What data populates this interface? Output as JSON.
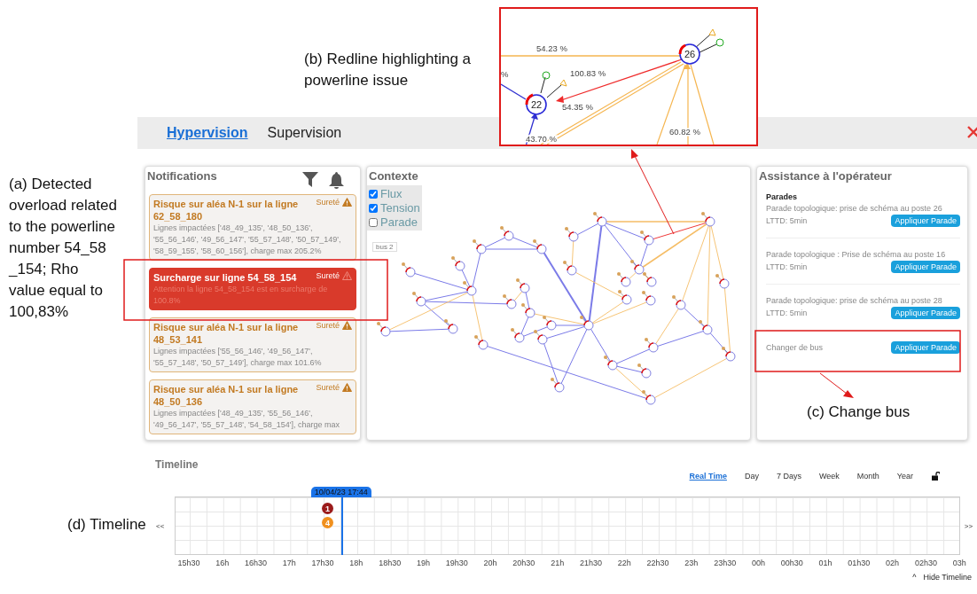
{
  "annotations": [
    {
      "kind": "a",
      "text": "(a) Detected overload related to the powerline number  54_58 _154; Rho value  equal to 100,83%"
    },
    {
      "kind": "b",
      "text": "(b) Redline highlighting a powerline issue"
    },
    {
      "kind": "c",
      "text": "(c) Change bus"
    },
    {
      "kind": "d",
      "text": "(d) Timeline"
    }
  ],
  "inset": {
    "flow_labels": [
      "54.23 %",
      "100.83 %",
      "54.35 %",
      "43.70 %",
      "60.82 %"
    ],
    "left_label": "%",
    "nodes": [
      "22",
      "26"
    ]
  },
  "header": {
    "tabs": [
      {
        "label": "Hypervision",
        "selected": true
      },
      {
        "label": "Supervision",
        "selected": false
      }
    ]
  },
  "notifications": {
    "title": "Notifications",
    "items": [
      {
        "kind": "risk",
        "title": "Risque sur aléa N-1 sur la ligne",
        "line_id": "62_58_180",
        "tag": "Sureté",
        "body": "Lignes impactées ['48_49_135', '48_50_136', '55_56_146', '49_56_147', '55_57_148', '50_57_149', '58_59_155', '58_60_156'], charge max 205.2%"
      },
      {
        "kind": "overload",
        "title": "Surcharge sur ligne 54_58_154",
        "tag": "Sureté",
        "body": "Attention la ligne 54_58_154 est en surcharge de 100.8%"
      },
      {
        "kind": "risk",
        "title": "Risque sur aléa N-1 sur la ligne",
        "line_id": "48_53_141",
        "tag": "Sureté",
        "body": "Lignes impactées ['55_56_146', '49_56_147', '55_57_148', '50_57_149'], charge max 101.6%"
      },
      {
        "kind": "risk",
        "title": "Risque sur aléa N-1 sur la ligne",
        "line_id": "48_50_136",
        "tag": "Sureté",
        "body": "Lignes impactées ['48_49_135', '55_56_146', '49_56_147', '55_57_148', '54_58_154'], charge max"
      }
    ]
  },
  "context": {
    "title": "Contexte",
    "layers": [
      {
        "label": "Flux",
        "checked": true
      },
      {
        "label": "Tension",
        "checked": true
      },
      {
        "label": "Parade",
        "checked": false
      }
    ],
    "legend": "bus 2"
  },
  "assistance": {
    "title": "Assistance à l'opérateur",
    "section": "Parades",
    "items": [
      {
        "text": "Parade topologique: prise de schéma au poste 26",
        "lttd": "LTTD: 5min",
        "button": "Appliquer Parade"
      },
      {
        "text": "Parade topologique : Prise de schéma au poste 16",
        "lttd": "LTTD: 5min",
        "button": "Appliquer Parade"
      },
      {
        "text": "Parade topologique: prise de schéma au poste 28",
        "lttd": "LTTD: 5min",
        "button": "Appliquer Parade"
      },
      {
        "text": "Changer de bus",
        "button": "Appliquer Parade"
      }
    ]
  },
  "timeline": {
    "title": "Timeline",
    "ranges": [
      {
        "label": "Real Time",
        "selected": true
      },
      {
        "label": "Day",
        "selected": false
      },
      {
        "label": "7 Days",
        "selected": false
      },
      {
        "label": "Week",
        "selected": false
      },
      {
        "label": "Month",
        "selected": false
      },
      {
        "label": "Year",
        "selected": false
      }
    ],
    "prev": "<<",
    "next": ">>",
    "cursor": "10/04/23 17:44",
    "events": [
      {
        "label": "1",
        "color": "#9b1b1b"
      },
      {
        "label": "4",
        "color": "#f0901e"
      }
    ],
    "ticks": [
      "15h30",
      "16h",
      "16h30",
      "17h",
      "17h30",
      "18h",
      "18h30",
      "19h",
      "19h30",
      "20h",
      "20h30",
      "21h",
      "21h30",
      "22h",
      "22h30",
      "23h",
      "23h30",
      "00h",
      "00h30",
      "01h",
      "01h30",
      "02h",
      "02h30",
      "03h"
    ],
    "hide": {
      "icon": "^",
      "label": "Hide Timeline"
    }
  }
}
